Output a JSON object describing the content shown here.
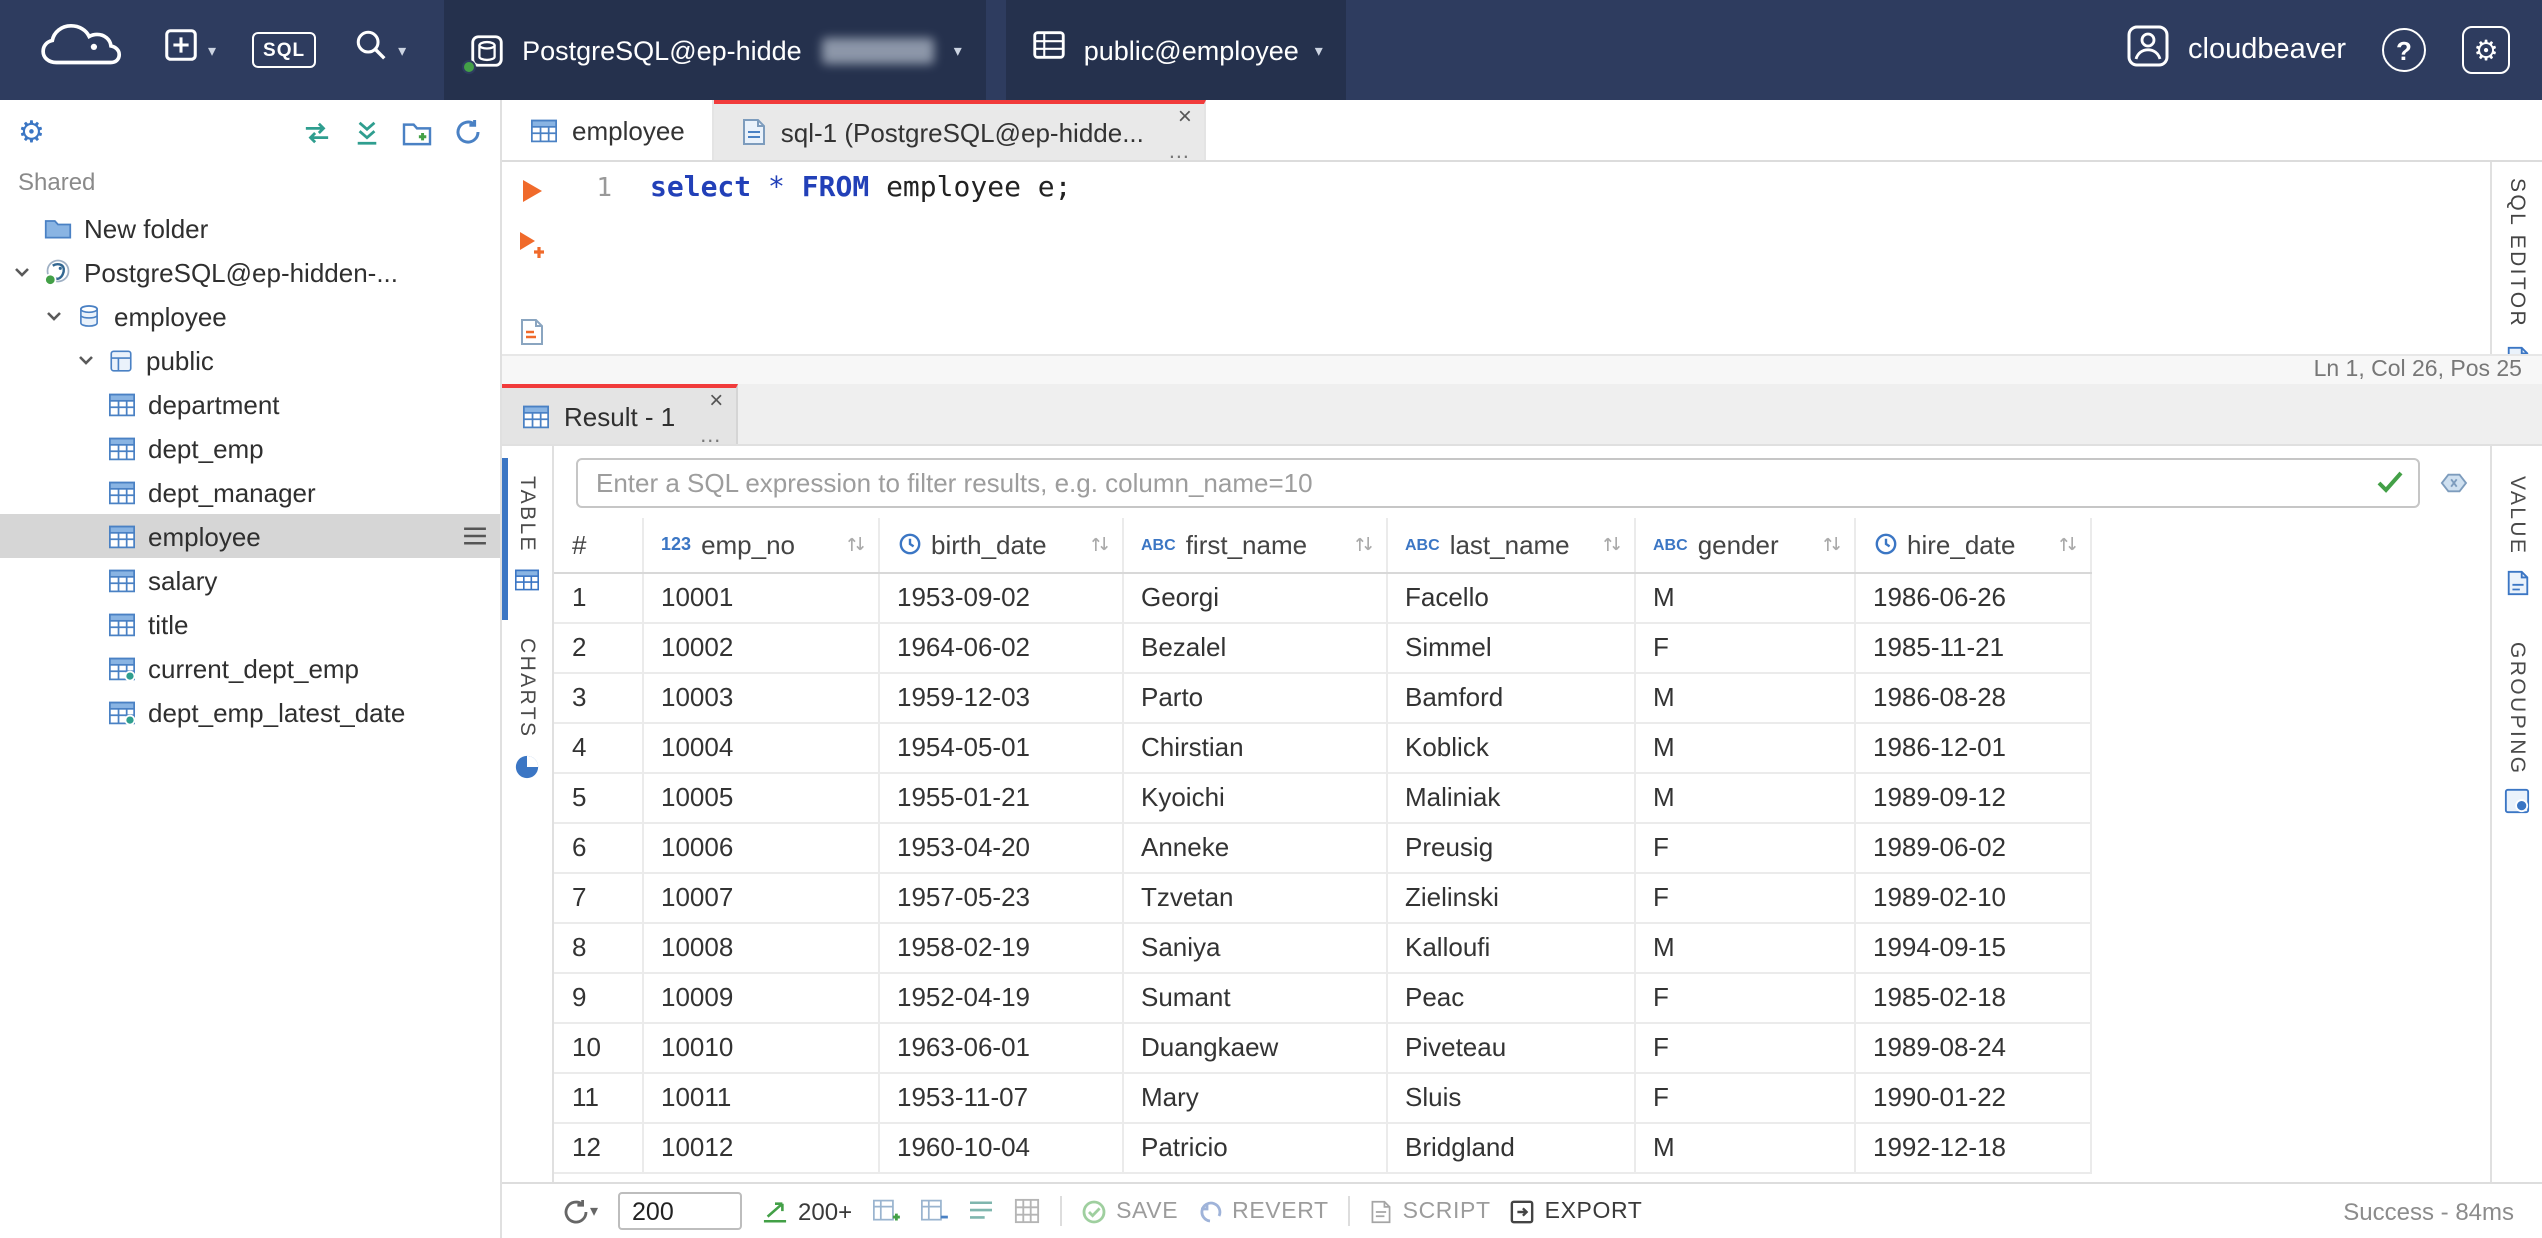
{
  "topbar": {
    "sql_button_label": "SQL",
    "connection_label": "PostgreSQL@ep-hidde",
    "schema_label": "public@employee",
    "user_label": "cloudbeaver",
    "help_glyph": "?"
  },
  "sidebar": {
    "section_label": "Shared",
    "items": [
      {
        "label": "New folder",
        "icon": "folder",
        "indent": 1,
        "chevron": false
      },
      {
        "label": "PostgreSQL@ep-hidden-...",
        "icon": "postgres",
        "indent": 1,
        "chevron": true
      },
      {
        "label": "employee",
        "icon": "database",
        "indent": 2,
        "chevron": true
      },
      {
        "label": "public",
        "icon": "schema",
        "indent": 3,
        "chevron": true
      },
      {
        "label": "department",
        "icon": "table",
        "indent": 4
      },
      {
        "label": "dept_emp",
        "icon": "table",
        "indent": 4
      },
      {
        "label": "dept_manager",
        "icon": "table",
        "indent": 4
      },
      {
        "label": "employee",
        "icon": "table",
        "indent": 4,
        "selected": true
      },
      {
        "label": "salary",
        "icon": "table",
        "indent": 4
      },
      {
        "label": "title",
        "icon": "table",
        "indent": 4
      },
      {
        "label": "current_dept_emp",
        "icon": "view",
        "indent": 4
      },
      {
        "label": "dept_emp_latest_date",
        "icon": "view",
        "indent": 4
      }
    ]
  },
  "tabs": [
    {
      "label": "employee"
    },
    {
      "label": "sql-1 (PostgreSQL@ep-hidde...",
      "active": true
    }
  ],
  "editor": {
    "line_number": "1",
    "sql_text": "select * FROM employee e;",
    "tokens": [
      {
        "text": "select",
        "type": "keyword"
      },
      {
        "text": " ",
        "type": "plain"
      },
      {
        "text": "*",
        "type": "operator"
      },
      {
        "text": " ",
        "type": "plain"
      },
      {
        "text": "FROM",
        "type": "keyword"
      },
      {
        "text": " employee e;",
        "type": "plain"
      }
    ],
    "status_text": "Ln 1, Col 26, Pos 25",
    "side_tab_label": "SQL EDITOR"
  },
  "result": {
    "tab_label": "Result - 1",
    "filter_placeholder": "Enter a SQL expression to filter results, e.g. column_name=10",
    "left_tabs": [
      "TABLE",
      "CHARTS"
    ],
    "right_tabs": [
      "VALUE",
      "GROUPING"
    ],
    "grid": {
      "columns": [
        {
          "name": "#",
          "type": "rownum"
        },
        {
          "name": "emp_no",
          "type": "number"
        },
        {
          "name": "birth_date",
          "type": "date"
        },
        {
          "name": "first_name",
          "type": "text"
        },
        {
          "name": "last_name",
          "type": "text"
        },
        {
          "name": "gender",
          "type": "text"
        },
        {
          "name": "hire_date",
          "type": "date"
        }
      ],
      "rows": [
        [
          "1",
          "10001",
          "1953-09-02",
          "Georgi",
          "Facello",
          "M",
          "1986-06-26"
        ],
        [
          "2",
          "10002",
          "1964-06-02",
          "Bezalel",
          "Simmel",
          "F",
          "1985-11-21"
        ],
        [
          "3",
          "10003",
          "1959-12-03",
          "Parto",
          "Bamford",
          "M",
          "1986-08-28"
        ],
        [
          "4",
          "10004",
          "1954-05-01",
          "Chirstian",
          "Koblick",
          "M",
          "1986-12-01"
        ],
        [
          "5",
          "10005",
          "1955-01-21",
          "Kyoichi",
          "Maliniak",
          "M",
          "1989-09-12"
        ],
        [
          "6",
          "10006",
          "1953-04-20",
          "Anneke",
          "Preusig",
          "F",
          "1989-06-02"
        ],
        [
          "7",
          "10007",
          "1957-05-23",
          "Tzvetan",
          "Zielinski",
          "F",
          "1989-02-10"
        ],
        [
          "8",
          "10008",
          "1958-02-19",
          "Saniya",
          "Kalloufi",
          "M",
          "1994-09-15"
        ],
        [
          "9",
          "10009",
          "1952-04-19",
          "Sumant",
          "Peac",
          "F",
          "1985-02-18"
        ],
        [
          "10",
          "10010",
          "1963-06-01",
          "Duangkaew",
          "Piveteau",
          "F",
          "1989-08-24"
        ],
        [
          "11",
          "10011",
          "1953-11-07",
          "Mary",
          "Sluis",
          "F",
          "1990-01-22"
        ],
        [
          "12",
          "10012",
          "1960-10-04",
          "Patricio",
          "Bridgland",
          "M",
          "1992-12-18"
        ]
      ]
    }
  },
  "toolbar": {
    "row_limit_value": "200",
    "limit_label": "200+",
    "save_label": "SAVE",
    "revert_label": "REVERT",
    "script_label": "SCRIPT",
    "export_label": "EXPORT",
    "status_text": "Success - 84ms"
  },
  "colors": {
    "topbar_bg": "#2e3c5f",
    "accent_blue": "#3b76c4",
    "active_tab_red": "#f13b3b",
    "run_orange": "#f06a2b",
    "success_green": "#43a047"
  }
}
